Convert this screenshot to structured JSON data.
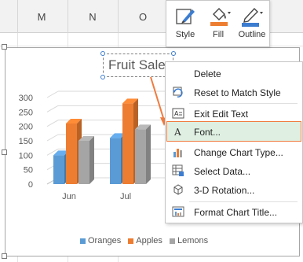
{
  "columns": [
    "M",
    "N",
    "O"
  ],
  "mini_toolbar": {
    "buttons": [
      {
        "label": "Style",
        "icon": "style-brush-icon"
      },
      {
        "label": "Fill",
        "icon": "fill-bucket-icon"
      },
      {
        "label": "Outline",
        "icon": "outline-pen-icon"
      }
    ]
  },
  "chart": {
    "title": "Fruit Sales",
    "legend": [
      "Oranges",
      "Apples",
      "Lemons"
    ]
  },
  "context_menu": {
    "items": [
      {
        "label": "Delete",
        "icon": "none"
      },
      {
        "label": "Reset to Match Style",
        "icon": "reset-style-icon"
      },
      {
        "label": "Exit Edit Text",
        "icon": "exit-edit-text-icon"
      },
      {
        "label": "Font...",
        "icon": "font-icon",
        "highlighted": true
      },
      {
        "label": "Change Chart Type...",
        "icon": "change-chart-type-icon"
      },
      {
        "label": "Select Data...",
        "icon": "select-data-icon"
      },
      {
        "label": "3-D Rotation...",
        "icon": "rotation-3d-icon"
      },
      {
        "label": "Format Chart Title...",
        "icon": "format-title-icon"
      }
    ]
  },
  "colors": {
    "oranges": "#5b9bd5",
    "apples": "#ed7d31",
    "lemons": "#a5a5a5",
    "highlight_border": "#f07b3f",
    "highlight_fill": "#dff0e2"
  },
  "chart_data": {
    "type": "bar",
    "title": "Fruit Sales",
    "categories": [
      "Jun",
      "Jul"
    ],
    "series": [
      {
        "name": "Oranges",
        "values": [
          100,
          160
        ]
      },
      {
        "name": "Apples",
        "values": [
          210,
          280
        ]
      },
      {
        "name": "Lemons",
        "values": [
          150,
          190
        ]
      }
    ],
    "yticks": [
      "0",
      "50",
      "100",
      "150",
      "200",
      "250",
      "300"
    ],
    "ylim": [
      0,
      300
    ],
    "legend_position": "bottom",
    "grid": true
  }
}
